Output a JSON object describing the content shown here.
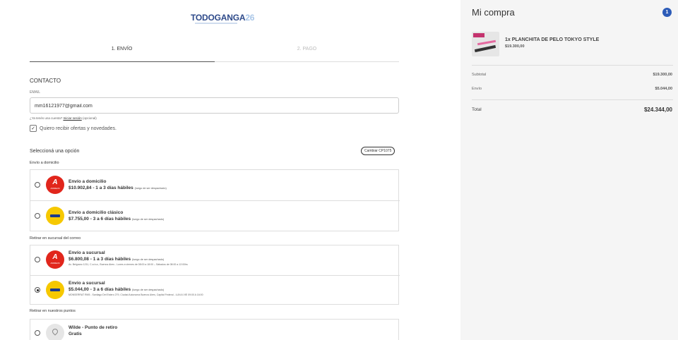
{
  "brand": {
    "part1": "TODO",
    "part2": "GANGA",
    "part3": "26"
  },
  "steps": [
    {
      "label": "1. ENVÍO"
    },
    {
      "label": "2. PAGO"
    }
  ],
  "contact": {
    "heading": "CONTACTO",
    "email_label": "EMAIL",
    "email_value": "mm16121977@gmail.com",
    "login_prefix": "¿Ya tenés una cuenta? ",
    "login_link": "Iniciar sesión",
    "login_suffix": " (opcional)",
    "newsletter_label": "Quiero recibir ofertas y novedades.",
    "newsletter_checked": true
  },
  "shipping": {
    "heading": "Seleccioná una opción",
    "change_cp_label": "Cambiar CP1075",
    "groups": [
      {
        "title": "Envío a domicilio",
        "options": [
          {
            "title": "Envío a domicilio",
            "price": "$10.902,84 - 1 a 3 días hábiles",
            "note": "(luego de ser despachado)",
            "address": "",
            "carrier": "andreani",
            "selected": false
          },
          {
            "title": "Envío a domicilio clásico",
            "price": "$7.755,00 - 3 a 6 días hábiles",
            "note": "(luego de ser despachado)",
            "address": "",
            "carrier": "correo-argentino",
            "selected": false
          }
        ]
      },
      {
        "title": "Retirar en sucursal del correo",
        "options": [
          {
            "title": "Envío a sucursal",
            "price": "$6.800,08 - 1 a 3 días hábiles",
            "note": "(luego de ser despachado)",
            "address": "Av. Belgrano 1211, C.a.b.a., Buenos Aires - Lunes a viernes de 08:00 a 18:00 – Sábados de 08:00 a 12:00hs",
            "carrier": "andreani",
            "selected": false
          },
          {
            "title": "Envío a sucursal",
            "price": "$5.044,00 - 3 a 6 días hábiles",
            "note": "(luego de ser despachado)",
            "address": "MONSERRAT RM5 - Santiago Del Estero 279, Ciudad Autonoma Buenos Aires, Capital Federal - LUN A VIE 09:00 A 16:00",
            "carrier": "correo-argentino",
            "selected": true
          }
        ]
      },
      {
        "title": "Retirar en nuestros puntos",
        "options": [
          {
            "title": "Wilde - Punto de retiro",
            "price": "Gratis",
            "note": "",
            "address": "",
            "carrier": "pickup",
            "selected": false
          }
        ]
      }
    ]
  },
  "cart": {
    "title": "Mi compra",
    "count": "1",
    "item_name": "1x PLANCHITA DE PELO TOKYO STYLE",
    "item_price": "$19.300,00",
    "subtotal_label": "Subtotal",
    "subtotal_value": "$19.300,00",
    "shipping_label": "Envío",
    "shipping_value": "$5.044,00",
    "total_label": "Total",
    "total_value": "$24.344,00"
  },
  "colors": {
    "brand_blue": "#2e4a8a",
    "brand_light": "#a9c6e8",
    "badge": "#2d5cb8",
    "andreani_red": "#e1261c",
    "correo_yellow": "#f6c800"
  }
}
